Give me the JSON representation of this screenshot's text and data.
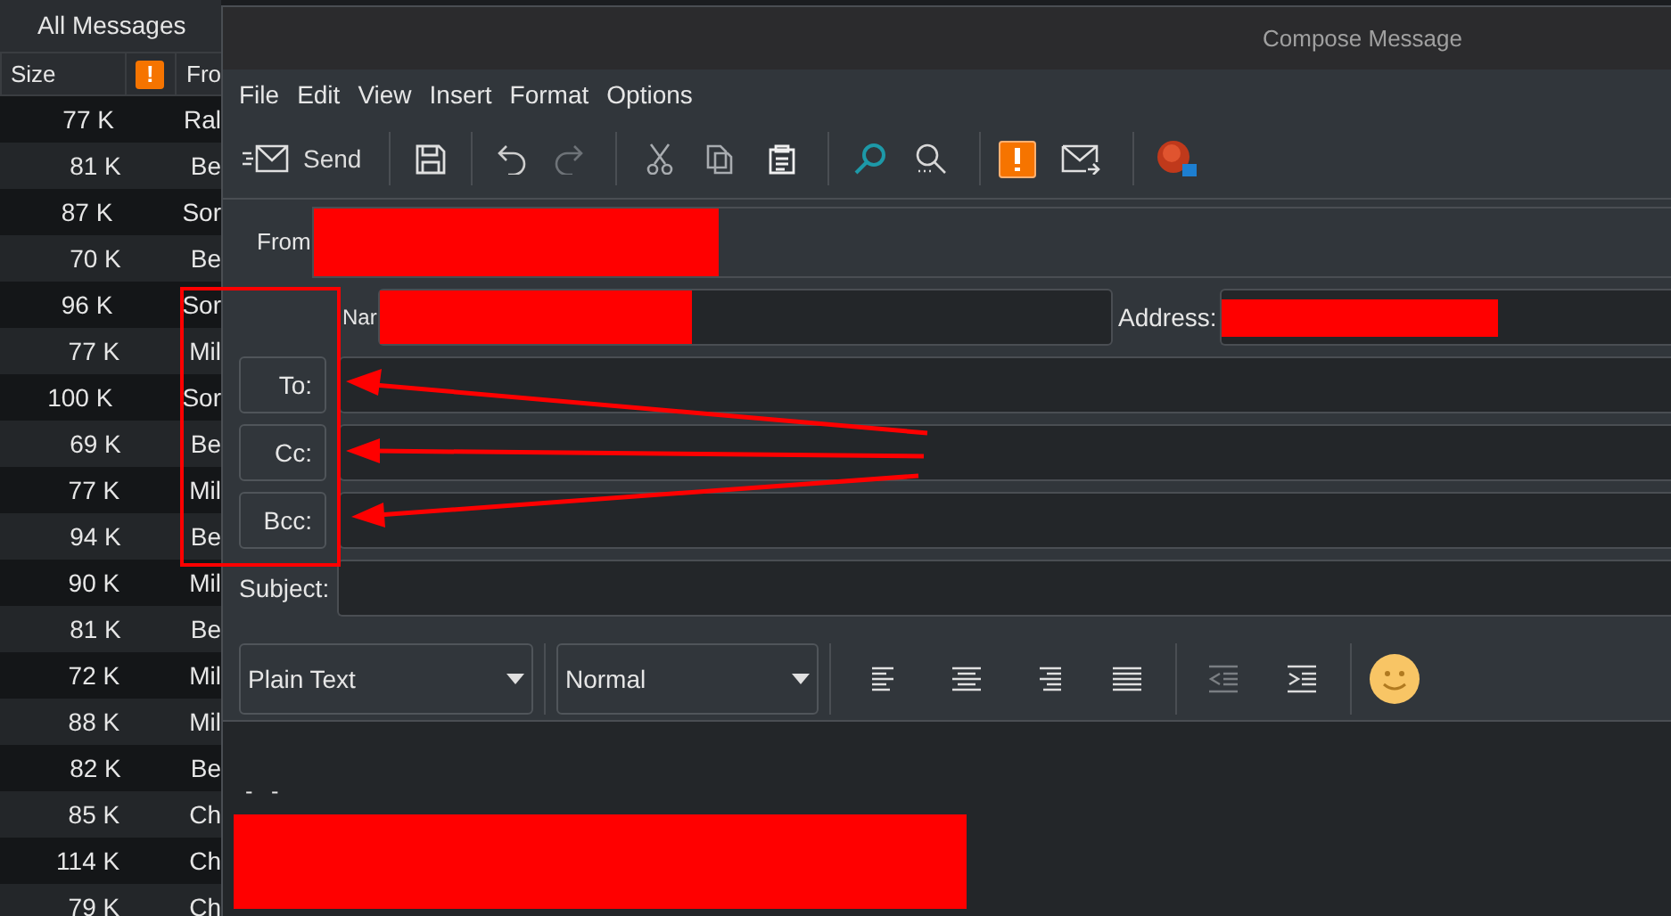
{
  "list_pane": {
    "tab": "All Messages",
    "columns": [
      "Size",
      "!",
      "Fro"
    ],
    "rows": [
      {
        "size": "77 K",
        "from": "Ral"
      },
      {
        "size": "81 K",
        "from": "Be"
      },
      {
        "size": "87 K",
        "from": "Sor"
      },
      {
        "size": "70 K",
        "from": "Be"
      },
      {
        "size": "96 K",
        "from": "Sor"
      },
      {
        "size": "77 K",
        "from": "Mil"
      },
      {
        "size": "100 K",
        "from": "Sor"
      },
      {
        "size": "69 K",
        "from": "Be"
      },
      {
        "size": "77 K",
        "from": "Mil"
      },
      {
        "size": "94 K",
        "from": "Be"
      },
      {
        "size": "90 K",
        "from": "Mil"
      },
      {
        "size": "81 K",
        "from": "Be"
      },
      {
        "size": "72 K",
        "from": "Mil"
      },
      {
        "size": "88 K",
        "from": "Mil"
      },
      {
        "size": "82 K",
        "from": "Be"
      },
      {
        "size": "85 K",
        "from": "Ch"
      },
      {
        "size": "114 K",
        "from": "Ch"
      },
      {
        "size": "79 K",
        "from": "Ch"
      }
    ]
  },
  "window": {
    "title": "Compose Message"
  },
  "menu": [
    "File",
    "Edit",
    "View",
    "Insert",
    "Format",
    "Options"
  ],
  "toolbar": {
    "send": "Send"
  },
  "header": {
    "from_label": "From",
    "name_label": "Nar",
    "address_label": "Address:",
    "recipients": [
      {
        "label": "To:"
      },
      {
        "label": "Cc:"
      },
      {
        "label": "Bcc:"
      }
    ],
    "subject_label": "Subject:"
  },
  "format_bar": {
    "mode": "Plain Text",
    "style": "Normal"
  },
  "body": {
    "signature": "- -"
  }
}
